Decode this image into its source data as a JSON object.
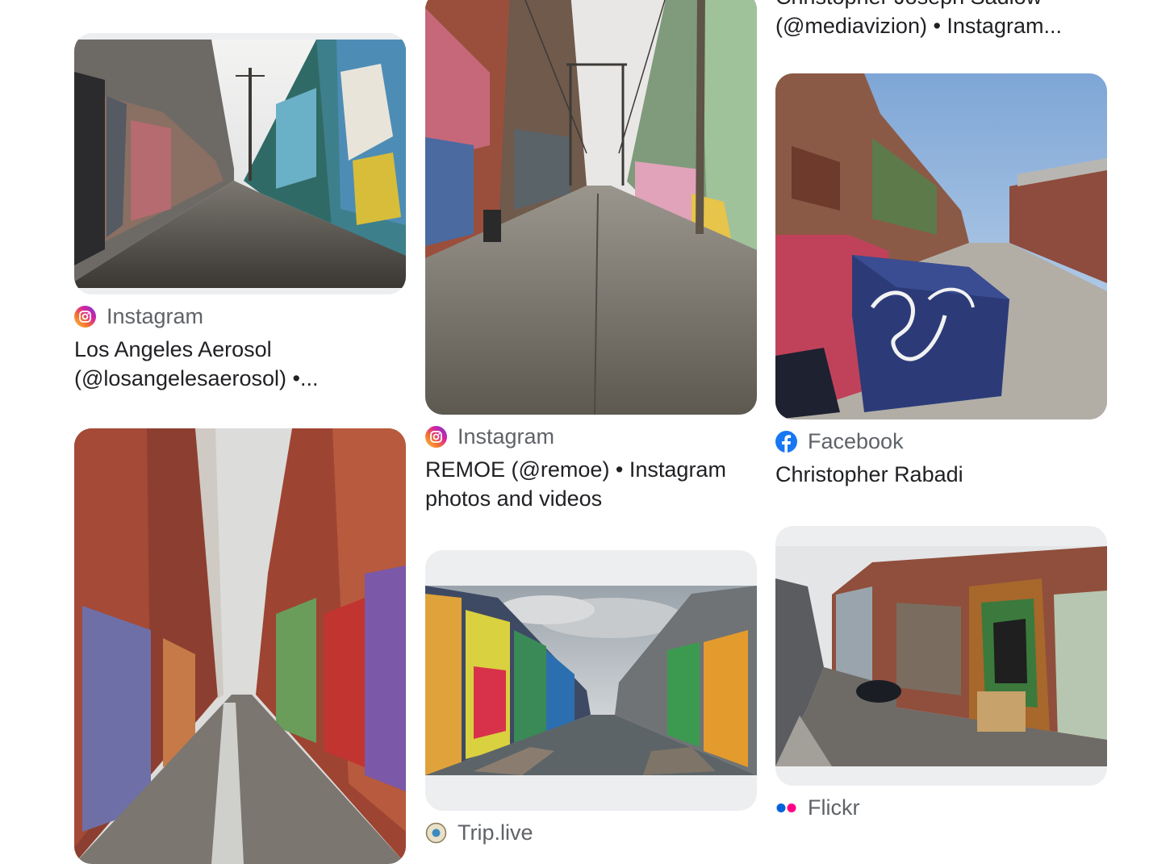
{
  "results": [
    {
      "source": "Instagram",
      "source_icon": "instagram-icon",
      "title": "Los Angeles Aerosol (@losangelesaerosol) •..."
    },
    {
      "source": "Instagram",
      "source_icon": "instagram-icon",
      "title": "REMOE (@remoe) • Instagram photos and videos"
    },
    {
      "source": "Facebook",
      "source_icon": "facebook-icon",
      "title": "Christopher Rabadi"
    },
    {
      "source": "Flickr",
      "source_icon": "flickr-icon",
      "title": ""
    },
    {
      "source": "Trip.live",
      "source_icon": "trip-live-icon",
      "title": ""
    }
  ],
  "partial_caption_top": {
    "line1": "Christopher Joseph Sadlow",
    "line2": "(@mediavizion) • Instagram..."
  },
  "colors": {
    "instagram_gradient": [
      "#f9c74f",
      "#f3722c",
      "#d6249f",
      "#6a3ad8"
    ],
    "facebook_blue": "#1877f2",
    "flickr_blue": "#0063dc",
    "flickr_pink": "#ff0084",
    "thumb_background": "#eceef0"
  }
}
